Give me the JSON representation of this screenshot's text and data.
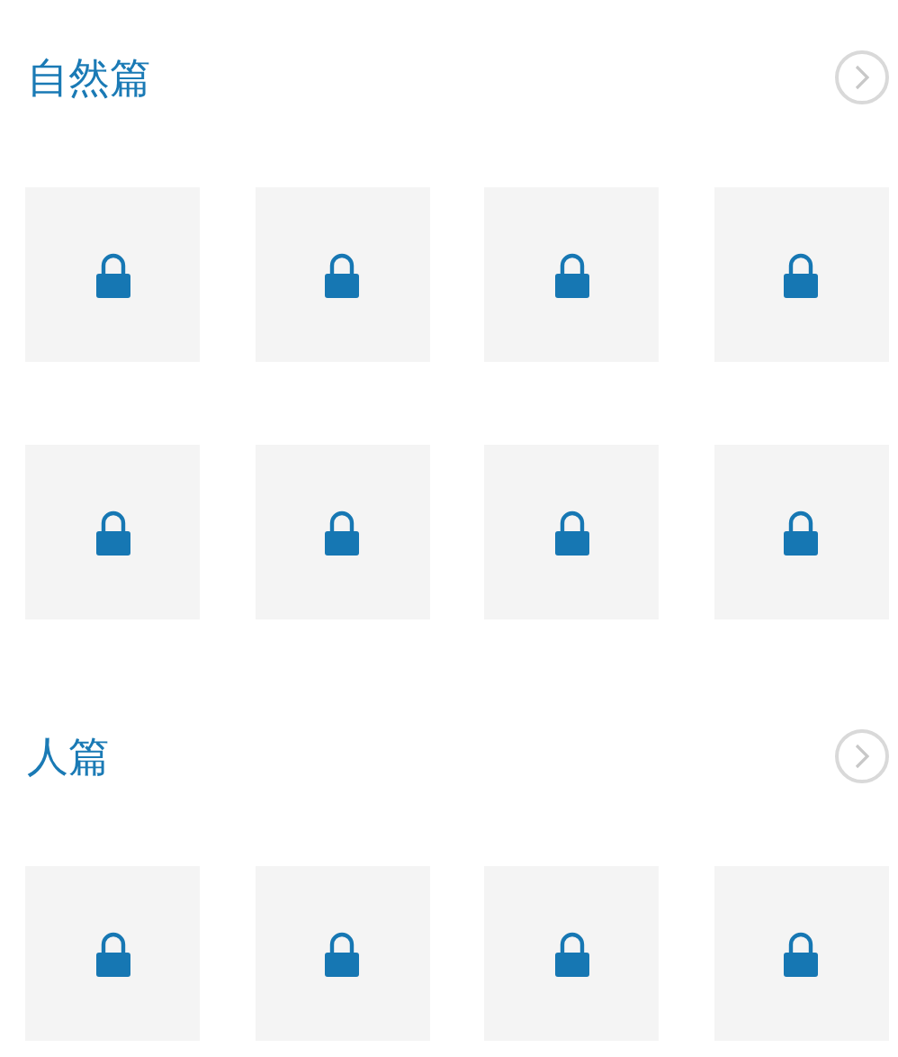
{
  "sections": [
    {
      "title": "自然篇",
      "items": [
        {
          "locked": true
        },
        {
          "locked": true
        },
        {
          "locked": true
        },
        {
          "locked": true
        },
        {
          "locked": true
        },
        {
          "locked": true
        },
        {
          "locked": true
        },
        {
          "locked": true
        }
      ]
    },
    {
      "title": "人篇",
      "items": [
        {
          "locked": true
        },
        {
          "locked": true
        },
        {
          "locked": true
        },
        {
          "locked": true
        }
      ]
    }
  ]
}
